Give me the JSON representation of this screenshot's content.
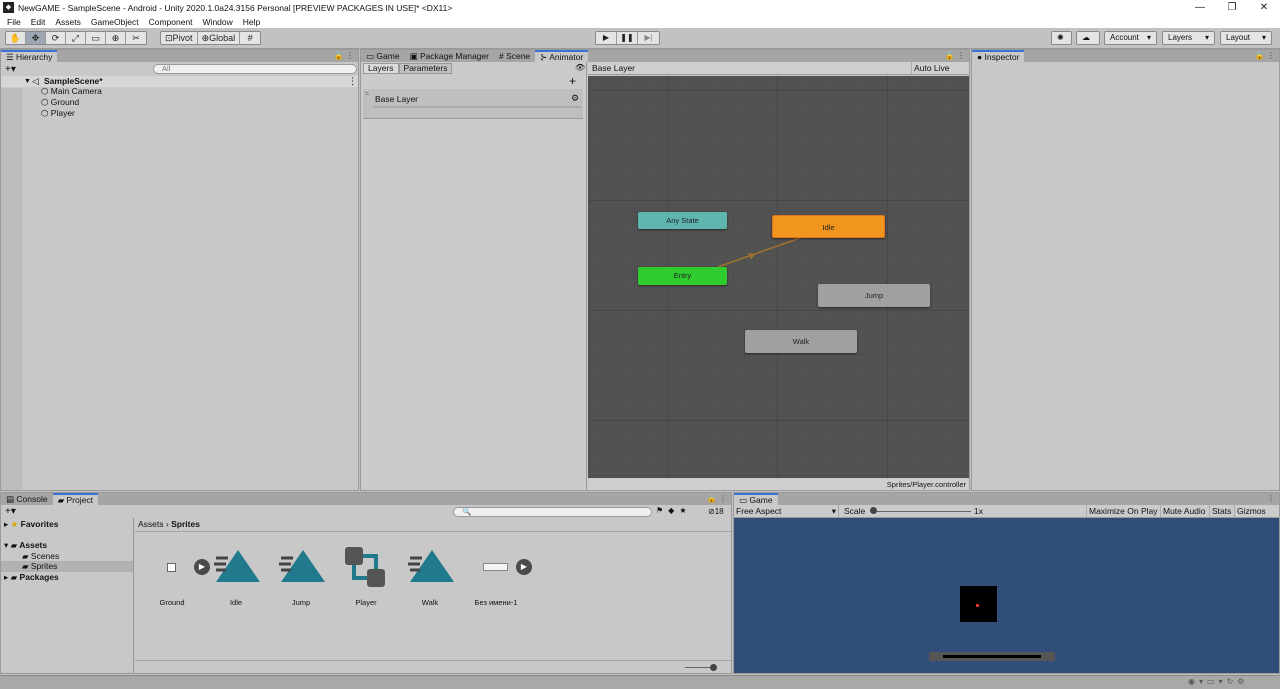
{
  "window": {
    "title": "NewGAME - SampleScene - Android - Unity 2020.1.0a24.3156 Personal [PREVIEW PACKAGES IN USE]* <DX11>"
  },
  "menu": [
    "File",
    "Edit",
    "Assets",
    "GameObject",
    "Component",
    "Window",
    "Help"
  ],
  "toolbar": {
    "pivot": "Pivot",
    "global": "Global",
    "account": "Account",
    "layers": "Layers",
    "layout": "Layout"
  },
  "hierarchy": {
    "tab": "Hierarchy",
    "search_placeholder": "All",
    "scene": "SampleScene*",
    "items": [
      "Main Camera",
      "Ground",
      "Player"
    ]
  },
  "center_tabs": [
    "Game",
    "Package Manager",
    "Scene",
    "Animator"
  ],
  "animator": {
    "sub_tabs": [
      "Layers",
      "Parameters"
    ],
    "layer_name": "Base Layer",
    "breadcrumb": "Base Layer",
    "auto_live_link": "Auto Live Link",
    "footer_path": "Sprites/Player.controller",
    "states": {
      "any": "Any State",
      "idle": "Idle",
      "entry": "Entry",
      "jump": "Jump",
      "walk": "Walk"
    },
    "colors": {
      "any": "#5fb6ae",
      "idle": "#f0951e",
      "entry": "#2fcc2f",
      "normal": "#a0a0a0",
      "grid": "#525252",
      "transition": "#a0722c"
    }
  },
  "inspector": {
    "tab": "Inspector"
  },
  "bottom_tabs": {
    "console": "Console",
    "project": "Project"
  },
  "project": {
    "tree": {
      "favorites": "Favorites",
      "assets": "Assets",
      "scenes": "Scenes",
      "sprites": "Sprites",
      "packages": "Packages"
    },
    "breadcrumb_root": "Assets",
    "breadcrumb_current": "Sprites",
    "count": "18",
    "assets": [
      "Ground",
      "Idle",
      "Jump",
      "Player",
      "Walk",
      "Без имени-1"
    ]
  },
  "game": {
    "tab": "Game",
    "aspect": "Free Aspect",
    "scale_label": "Scale",
    "scale_value": "1x",
    "maximize": "Maximize On Play",
    "mute": "Mute Audio",
    "stats": "Stats",
    "gizmos": "Gizmos",
    "background": "#314d79"
  }
}
